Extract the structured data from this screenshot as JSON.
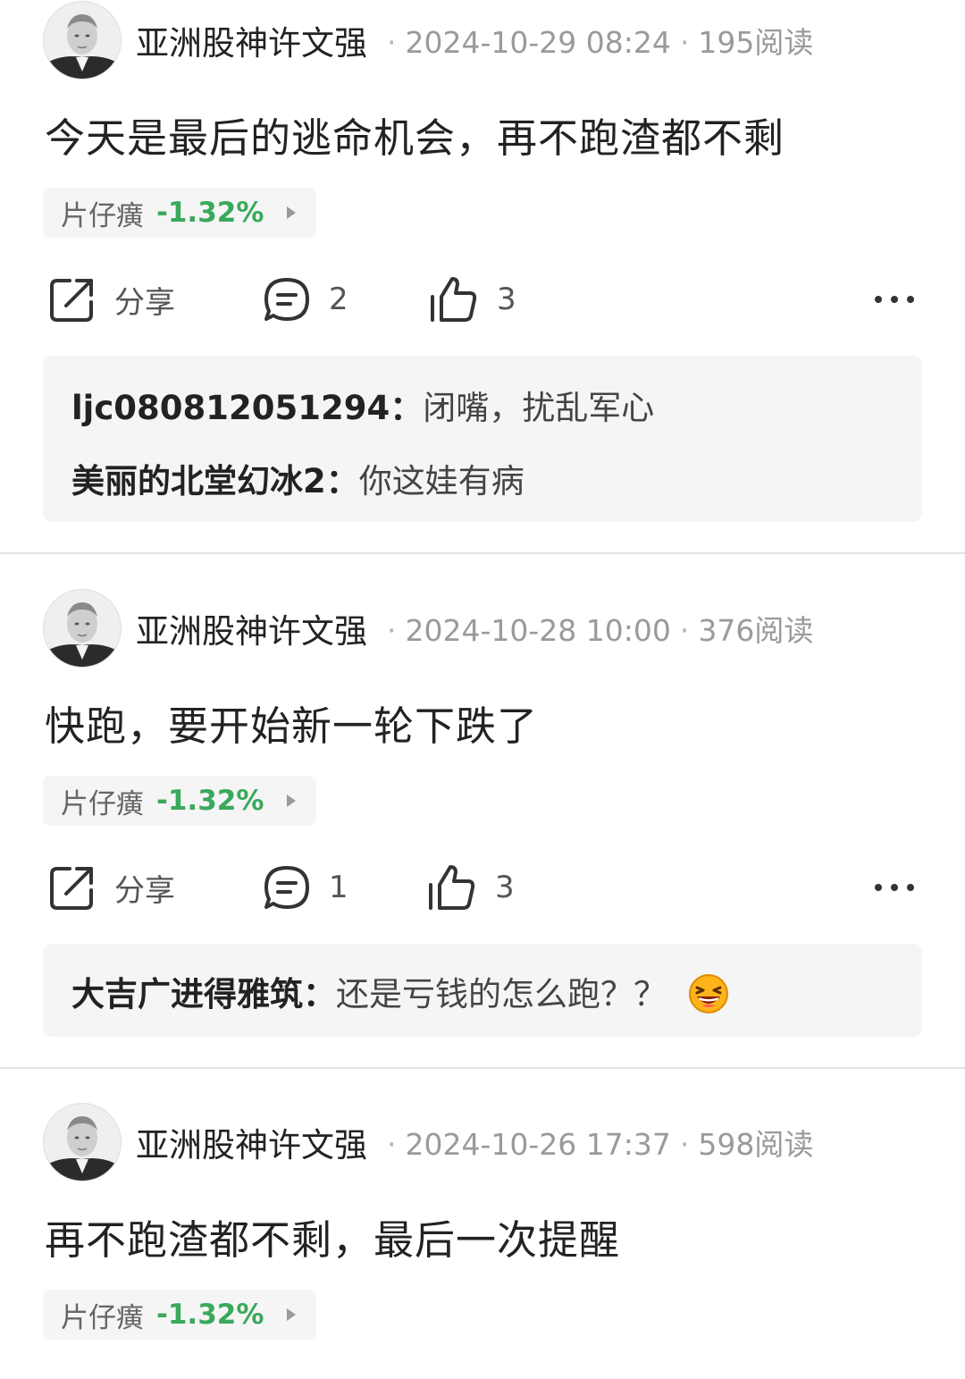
{
  "posts": [
    {
      "author": "亚洲股神许文强",
      "date": "2024-10-29 08:24",
      "reads": "195阅读",
      "content": "今天是最后的逃命机会，再不跑渣都不剩",
      "stock": {
        "name": "片仔癀",
        "change": "-1.32%"
      },
      "share_label": "分享",
      "comment_count": "2",
      "like_count": "3",
      "comments": [
        {
          "user": "ljc080812051294",
          "sep": "：",
          "text": "闭嘴，扰乱军心"
        },
        {
          "user": "美丽的北堂幻冰2",
          "sep": "：",
          "text": "你这娃有病"
        }
      ]
    },
    {
      "author": "亚洲股神许文强",
      "date": "2024-10-28 10:00",
      "reads": "376阅读",
      "content": "快跑，要开始新一轮下跌了",
      "stock": {
        "name": "片仔癀",
        "change": "-1.32%"
      },
      "share_label": "分享",
      "comment_count": "1",
      "like_count": "3",
      "comments": [
        {
          "user": "大吉广进得雅筑",
          "sep": "：",
          "text": "还是亏钱的怎么跑？？",
          "emoji": "laughing-face-emoji"
        }
      ]
    },
    {
      "author": "亚洲股神许文强",
      "date": "2024-10-26 17:37",
      "reads": "598阅读",
      "content": "再不跑渣都不剩，最后一次提醒",
      "stock": {
        "name": "片仔癀",
        "change": "-1.32%"
      }
    }
  ],
  "colors": {
    "stock_down": "#3aa95c",
    "meta_gray": "#9a9a9a",
    "chip_bg": "#f5f5f5"
  },
  "icons": {
    "share": "share-icon",
    "comment": "comment-icon",
    "like": "thumbs-up-icon",
    "more": "more-icon",
    "avatar": "avatar-portrait"
  }
}
